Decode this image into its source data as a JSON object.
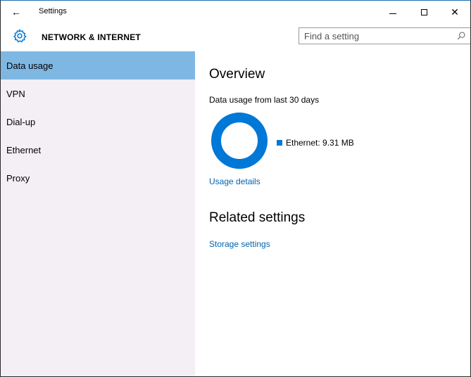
{
  "window": {
    "title": "Settings",
    "back_glyph": "←",
    "minimize_icon": "minimize-icon",
    "maximize_icon": "maximize-icon",
    "close_glyph": "✕"
  },
  "header": {
    "section_title": "NETWORK & INTERNET",
    "icon": "gear-icon",
    "search": {
      "placeholder": "Find a setting",
      "value": "",
      "icon": "search-icon"
    }
  },
  "sidebar": {
    "items": [
      {
        "label": "Data usage",
        "active": true
      },
      {
        "label": "VPN",
        "active": false
      },
      {
        "label": "Dial-up",
        "active": false
      },
      {
        "label": "Ethernet",
        "active": false
      },
      {
        "label": "Proxy",
        "active": false
      }
    ]
  },
  "main": {
    "overview_heading": "Overview",
    "usage_subtitle": "Data usage from last 30 days",
    "legend_label": "Ethernet: 9.31 MB",
    "usage_details_link": "Usage details",
    "related_heading": "Related settings",
    "storage_link": "Storage settings"
  },
  "colors": {
    "accent": "#0078d7",
    "selected_item": "#7fb7e3",
    "sidebar_bg": "#f3eff4",
    "link": "#0063b1"
  },
  "chart_data": {
    "type": "pie",
    "categories": [
      "Ethernet"
    ],
    "values": [
      9.31
    ],
    "unit": "MB"
  }
}
